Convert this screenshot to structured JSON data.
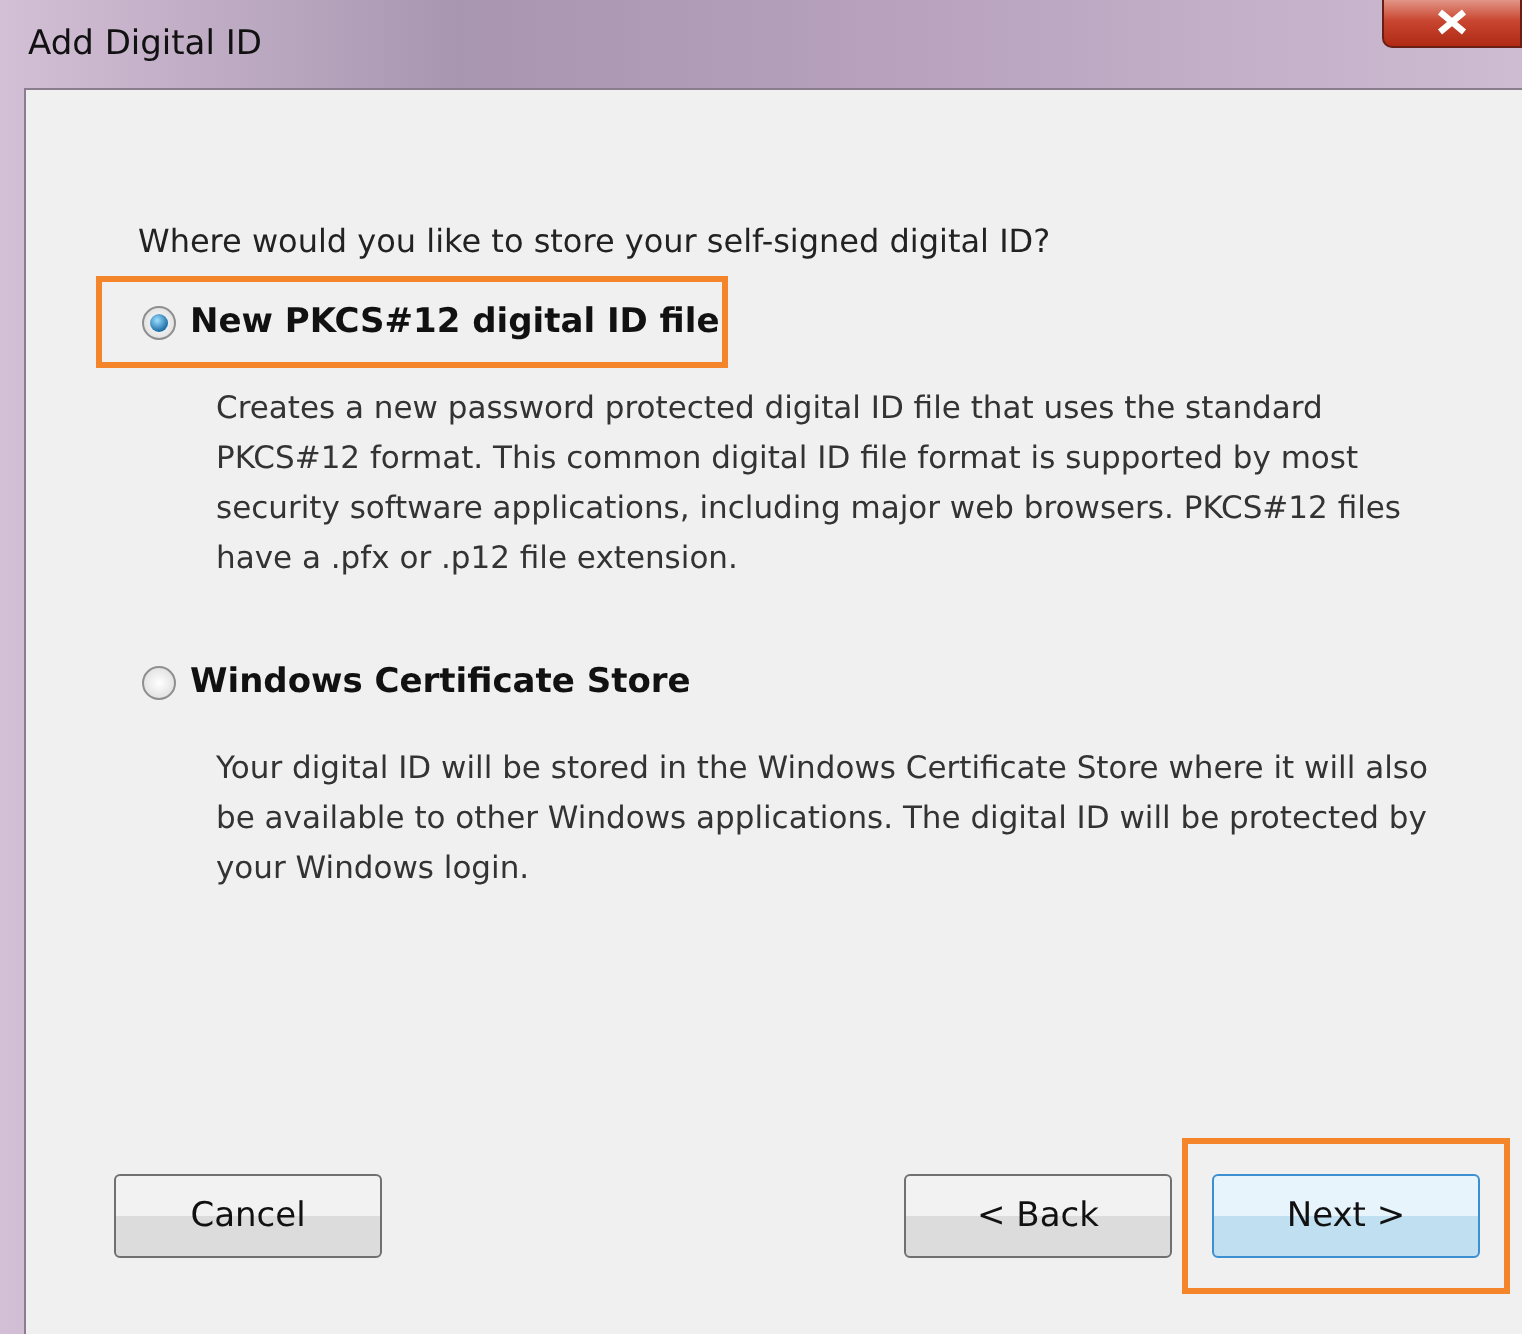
{
  "window": {
    "title": "Add Digital ID"
  },
  "question": "Where would you like to store your self-signed digital ID?",
  "options": [
    {
      "label": "New PKCS#12 digital ID file",
      "selected": true,
      "highlighted": true,
      "description": "Creates a new password protected digital ID file that uses the standard PKCS#12 format. This common digital ID file format is supported by most security software applications, including major web browsers. PKCS#12 files have a .pfx or .p12 file extension."
    },
    {
      "label": "Windows Certificate Store",
      "selected": false,
      "highlighted": false,
      "description": "Your digital ID will be stored in the Windows Certificate Store where it will also be available to other Windows applications. The digital ID will be protected by your Windows login."
    }
  ],
  "buttons": [
    {
      "label": "Cancel",
      "default": false,
      "highlighted": false
    },
    {
      "label": "< Back",
      "default": false,
      "highlighted": false
    },
    {
      "label": "Next >",
      "default": true,
      "highlighted": true
    }
  ]
}
